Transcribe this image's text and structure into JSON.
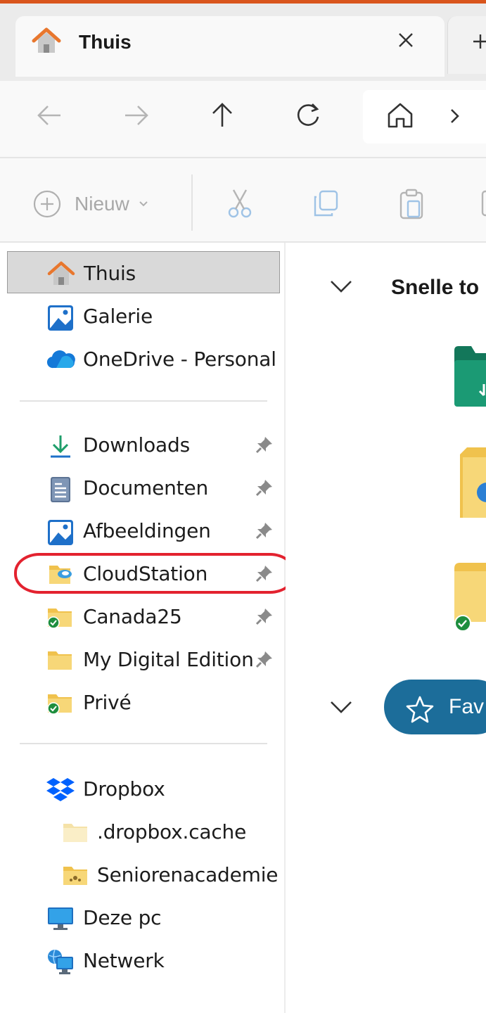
{
  "tab": {
    "title": "Thuis"
  },
  "commandbar": {
    "new_label": "Nieuw"
  },
  "sidebar": {
    "top_items": [
      {
        "label": "Thuis",
        "icon": "home-icon",
        "selected": true
      },
      {
        "label": "Galerie",
        "icon": "gallery-icon"
      },
      {
        "label": "OneDrive - Personal",
        "icon": "onedrive-icon"
      }
    ],
    "pinned_items": [
      {
        "label": "Downloads",
        "icon": "download-icon",
        "pinned": true
      },
      {
        "label": "Documenten",
        "icon": "document-icon",
        "pinned": true
      },
      {
        "label": "Afbeeldingen",
        "icon": "pictures-icon",
        "pinned": true
      },
      {
        "label": "CloudStation",
        "icon": "cloud-folder-icon",
        "pinned": true,
        "highlighted": true
      },
      {
        "label": "Canada25",
        "icon": "synced-folder-icon",
        "pinned": true
      },
      {
        "label": "My Digital Edition",
        "icon": "folder-icon",
        "pinned": true
      },
      {
        "label": "Privé",
        "icon": "synced-folder-icon",
        "pinned": false
      }
    ],
    "bottom_items": [
      {
        "label": "Dropbox",
        "icon": "dropbox-icon"
      },
      {
        "label": ".dropbox.cache",
        "icon": "folder-icon",
        "sub": true
      },
      {
        "label": "Seniorenacademie",
        "icon": "shared-folder-icon",
        "sub": true
      },
      {
        "label": "Deze pc",
        "icon": "computer-icon"
      },
      {
        "label": "Netwerk",
        "icon": "network-icon"
      }
    ]
  },
  "content": {
    "quick_access_title": "Snelle to",
    "favorites_label": "Fav"
  },
  "colors": {
    "accent": "#1c6d9a",
    "highlight_ring": "#e3222f",
    "selected_bg": "#d9d9d9"
  }
}
